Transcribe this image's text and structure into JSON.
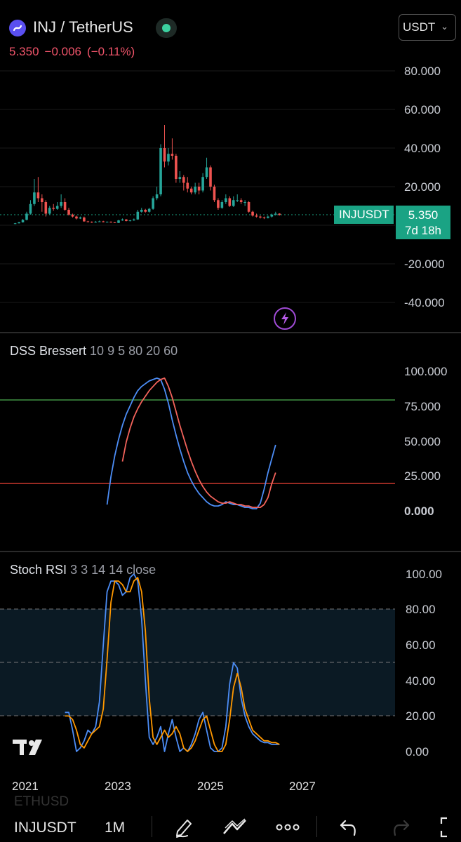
{
  "header": {
    "pair_title": "INJ / TetherUS",
    "price": "5.350",
    "change": "−0.006",
    "change_pct": "(−0.11%)",
    "currency": "USDT"
  },
  "main_pane": {
    "y_ticks": [
      "80.000",
      "60.000",
      "40.000",
      "20.000",
      "-20.000",
      "-40.000"
    ],
    "symbol_badge": "INJUSDT",
    "price_badge": "5.350",
    "countdown": "7d 18h",
    "colors": {
      "up": "#26a69a",
      "down": "#ef5350",
      "badge": "#1aa384"
    }
  },
  "dss_pane": {
    "title": "DSS Bressert",
    "params": "10 9 5 80 20 60",
    "y_ticks": [
      "100.000",
      "75.000",
      "50.000",
      "25.000",
      "0.000"
    ],
    "colors": {
      "fast": "#4c8df6",
      "slow": "#f3635b",
      "upper_level": "#4caf50",
      "lower_level": "#f44336"
    }
  },
  "stoch_pane": {
    "title": "Stoch RSI",
    "params": "3 3 14 14 close",
    "y_ticks": [
      "100.00",
      "80.00",
      "60.00",
      "40.00",
      "20.00",
      "0.00"
    ],
    "colors": {
      "k": "#4c8df6",
      "d": "#ff9800",
      "band": "#0b1a24"
    }
  },
  "x_axis": {
    "years": [
      "2021",
      "2023",
      "2025",
      "2027"
    ]
  },
  "bottom_bar": {
    "ghost_symbol": "ETHUSD",
    "symbol": "INJUSDT",
    "interval": "1M",
    "icons": [
      "pencil-icon",
      "drawing-tools-icon",
      "more-icon",
      "undo-icon",
      "redo-icon",
      "fullscreen-icon"
    ]
  },
  "chart_data": [
    {
      "type": "candlestick",
      "title": "INJ / TetherUS",
      "x": [
        "2020-10",
        "2020-11",
        "2020-12",
        "2021-01",
        "2021-02",
        "2021-03",
        "2021-04",
        "2021-05",
        "2021-06",
        "2021-07",
        "2021-08",
        "2021-09",
        "2021-10",
        "2021-11",
        "2021-12",
        "2022-01",
        "2022-02",
        "2022-03",
        "2022-04",
        "2022-05",
        "2022-06",
        "2022-07",
        "2022-08",
        "2022-09",
        "2022-10",
        "2022-11",
        "2022-12",
        "2023-01",
        "2023-02",
        "2023-03",
        "2023-04",
        "2023-05",
        "2023-06",
        "2023-07",
        "2023-08",
        "2023-09",
        "2023-10",
        "2023-11",
        "2023-12",
        "2024-01",
        "2024-02",
        "2024-03",
        "2024-04",
        "2024-05",
        "2024-06",
        "2024-07",
        "2024-08",
        "2024-09",
        "2024-10",
        "2024-11",
        "2024-12",
        "2025-01",
        "2025-02",
        "2025-03",
        "2025-04",
        "2025-05",
        "2025-06",
        "2025-07",
        "2025-08",
        "2025-09",
        "2025-10",
        "2025-11",
        "2025-12",
        "2026-01",
        "2026-02",
        "2026-03",
        "2026-04",
        "2026-05",
        "2026-06",
        "2026-07"
      ],
      "open": [
        0.8,
        1.0,
        1.5,
        2.8,
        6.0,
        11.0,
        17.0,
        14.0,
        12.0,
        6.0,
        9.0,
        8.5,
        10.0,
        12.0,
        8.0,
        5.5,
        4.5,
        3.5,
        4.0,
        2.0,
        1.8,
        1.5,
        1.8,
        2.0,
        1.6,
        1.8,
        1.5,
        1.2,
        2.5,
        3.0,
        2.2,
        2.5,
        3.0,
        7.0,
        8.0,
        7.0,
        8.5,
        14.0,
        16.0,
        40.0,
        33.0,
        37.0,
        36.0,
        24.0,
        25.0,
        22.0,
        19.0,
        17.0,
        20.0,
        18.0,
        25.0,
        30.0,
        20.0,
        13.0,
        9.0,
        12.0,
        14.0,
        10.0,
        13.0,
        13.0,
        12.0,
        12.0,
        7.0,
        5.0,
        4.5,
        4.0,
        3.8,
        4.5,
        5.5,
        6.0
      ],
      "close": [
        1.0,
        1.5,
        2.8,
        6.0,
        11.0,
        17.0,
        14.0,
        12.0,
        6.0,
        9.0,
        8.5,
        10.0,
        12.0,
        8.0,
        5.5,
        4.5,
        3.5,
        4.0,
        2.0,
        1.8,
        1.5,
        1.8,
        2.0,
        1.6,
        1.8,
        1.5,
        1.2,
        2.5,
        3.0,
        2.2,
        2.5,
        3.0,
        7.0,
        8.0,
        7.0,
        8.5,
        14.0,
        16.0,
        40.0,
        33.0,
        37.0,
        36.0,
        24.0,
        25.0,
        22.0,
        19.0,
        17.0,
        20.0,
        18.0,
        25.0,
        30.0,
        20.0,
        13.0,
        9.0,
        12.0,
        14.0,
        10.0,
        13.0,
        13.0,
        12.0,
        12.0,
        7.0,
        5.0,
        4.5,
        4.0,
        3.8,
        4.5,
        5.5,
        6.0,
        5.35
      ],
      "high": [
        1.2,
        1.8,
        3.2,
        7.0,
        13.0,
        24.0,
        25.0,
        16.0,
        13.0,
        10.0,
        11.0,
        12.0,
        16.0,
        14.0,
        9.0,
        6.0,
        5.0,
        4.5,
        4.5,
        2.3,
        2.0,
        2.2,
        2.4,
        2.3,
        2.0,
        2.0,
        1.6,
        2.8,
        3.5,
        3.2,
        2.8,
        3.5,
        8.0,
        9.0,
        8.5,
        9.0,
        15.0,
        20.0,
        42.0,
        52.0,
        40.0,
        45.0,
        37.0,
        28.0,
        26.0,
        25.0,
        20.0,
        22.0,
        22.0,
        27.0,
        35.0,
        31.0,
        21.0,
        14.0,
        13.0,
        16.0,
        15.0,
        15.0,
        16.0,
        14.0,
        13.0,
        12.5,
        7.5,
        6.0,
        5.0,
        4.5,
        5.0,
        6.0,
        7.0,
        6.2
      ],
      "low": [
        0.6,
        0.9,
        1.4,
        2.5,
        5.5,
        10.0,
        12.0,
        7.0,
        4.5,
        5.5,
        7.5,
        8.0,
        9.0,
        7.5,
        5.0,
        4.0,
        3.0,
        3.2,
        1.8,
        1.5,
        1.2,
        1.3,
        1.6,
        1.5,
        1.4,
        1.3,
        1.1,
        1.1,
        2.3,
        2.0,
        2.0,
        2.3,
        2.8,
        6.5,
        6.5,
        6.5,
        8.0,
        13.0,
        15.0,
        30.0,
        31.0,
        34.0,
        22.0,
        22.0,
        18.0,
        17.0,
        16.0,
        16.0,
        16.0,
        17.0,
        24.0,
        18.0,
        12.0,
        8.0,
        8.5,
        11.0,
        9.5,
        9.5,
        12.0,
        11.0,
        10.0,
        6.5,
        4.5,
        4.0,
        3.5,
        3.2,
        3.5,
        4.0,
        5.0,
        5.0
      ],
      "ylim": [
        -50,
        90
      ]
    },
    {
      "type": "line",
      "title": "DSS Bressert",
      "x": [
        "2022-10",
        "2022-11",
        "2022-12",
        "2023-01",
        "2023-02",
        "2023-03",
        "2023-04",
        "2023-05",
        "2023-06",
        "2023-07",
        "2023-08",
        "2023-09",
        "2023-10",
        "2023-11",
        "2023-12",
        "2024-01",
        "2024-02",
        "2024-03",
        "2024-04",
        "2024-05",
        "2024-06",
        "2024-07",
        "2024-08",
        "2024-09",
        "2024-10",
        "2024-11",
        "2024-12",
        "2025-01",
        "2025-02",
        "2025-03",
        "2025-04",
        "2025-05",
        "2025-06",
        "2025-07",
        "2025-08",
        "2025-09",
        "2025-10",
        "2025-11",
        "2025-12",
        "2026-01",
        "2026-02",
        "2026-03",
        "2026-04",
        "2026-05",
        "2026-06",
        "2026-07"
      ],
      "series": [
        {
          "values": [
            5,
            25,
            40,
            52,
            62,
            70,
            76,
            82,
            87,
            90,
            92,
            94,
            95,
            96,
            95,
            88,
            78,
            66,
            55,
            45,
            36,
            28,
            22,
            17,
            13,
            10,
            7,
            5,
            4,
            4,
            5,
            7,
            6,
            5,
            5,
            4,
            3,
            3,
            2,
            2,
            6,
            16,
            28,
            38,
            48
          ]
        },
        {
          "values": [
            null,
            null,
            null,
            null,
            36,
            50,
            60,
            68,
            74,
            79,
            83,
            87,
            90,
            93,
            95,
            96,
            90,
            82,
            72,
            62,
            53,
            44,
            36,
            29,
            23,
            18,
            14,
            11,
            9,
            7,
            6,
            6,
            7,
            6,
            5,
            5,
            4,
            4,
            3,
            3,
            3,
            5,
            10,
            20,
            28
          ]
        }
      ],
      "levels": [
        80,
        20
      ],
      "ylim": [
        -20,
        120
      ]
    },
    {
      "type": "line",
      "title": "Stoch RSI",
      "x": [
        "2021-11",
        "2021-12",
        "2022-01",
        "2022-02",
        "2022-03",
        "2022-04",
        "2022-05",
        "2022-06",
        "2022-07",
        "2022-08",
        "2022-09",
        "2022-10",
        "2022-11",
        "2022-12",
        "2023-01",
        "2023-02",
        "2023-03",
        "2023-04",
        "2023-05",
        "2023-06",
        "2023-07",
        "2023-08",
        "2023-09",
        "2023-10",
        "2023-11",
        "2023-12",
        "2024-01",
        "2024-02",
        "2024-03",
        "2024-04",
        "2024-05",
        "2024-06",
        "2024-07",
        "2024-08",
        "2024-09",
        "2024-10",
        "2024-11",
        "2024-12",
        "2025-01",
        "2025-02",
        "2025-03",
        "2025-04",
        "2025-05",
        "2025-06",
        "2025-07",
        "2025-08",
        "2025-09",
        "2025-10",
        "2025-11",
        "2025-12",
        "2026-01",
        "2026-02",
        "2026-03",
        "2026-04",
        "2026-05",
        "2026-06",
        "2026-07"
      ],
      "series": [
        {
          "values": [
            22,
            22,
            12,
            0,
            2,
            6,
            12,
            10,
            14,
            28,
            60,
            90,
            96,
            96,
            94,
            88,
            90,
            98,
            100,
            96,
            75,
            40,
            8,
            4,
            8,
            14,
            0,
            10,
            18,
            8,
            0,
            2,
            0,
            4,
            10,
            18,
            22,
            12,
            2,
            0,
            0,
            2,
            14,
            38,
            50,
            47,
            30,
            20,
            14,
            10,
            8,
            6,
            5,
            5,
            4,
            4,
            4
          ]
        },
        {
          "values": [
            20,
            20,
            18,
            12,
            4,
            2,
            6,
            10,
            12,
            14,
            24,
            52,
            84,
            96,
            96,
            94,
            90,
            90,
            96,
            98,
            90,
            68,
            30,
            8,
            4,
            8,
            12,
            8,
            10,
            14,
            10,
            2,
            0,
            2,
            6,
            12,
            18,
            20,
            12,
            4,
            0,
            0,
            4,
            18,
            36,
            44,
            36,
            24,
            18,
            12,
            10,
            8,
            6,
            6,
            5,
            5,
            4
          ]
        }
      ],
      "levels": [
        80,
        50,
        20
      ],
      "ylim": [
        -10,
        110
      ]
    }
  ]
}
